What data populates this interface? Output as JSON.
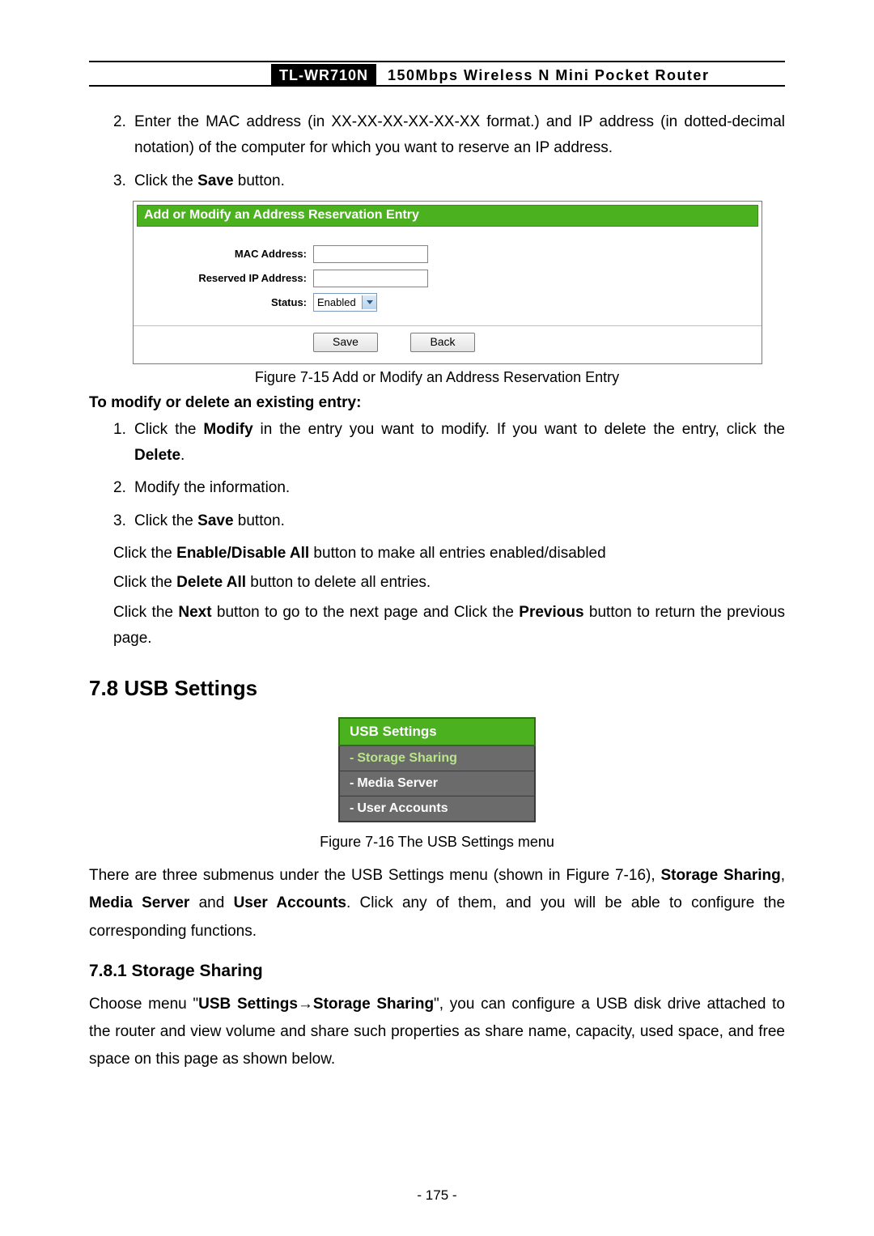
{
  "header": {
    "model": "TL-WR710N",
    "desc": "150Mbps Wireless N Mini Pocket Router"
  },
  "list1": {
    "item2_num": "2.",
    "item2_text": "Enter the MAC address (in XX-XX-XX-XX-XX-XX format.) and IP address (in dotted-decimal notation) of the computer for which you want to reserve an IP address.",
    "item3_num": "3.",
    "item3_a": "Click the ",
    "item3_b": "Save",
    "item3_c": " button."
  },
  "fig1": {
    "title": "Add or Modify an Address Reservation Entry",
    "label_mac": "MAC Address:",
    "label_ip": "Reserved IP Address:",
    "label_status": "Status:",
    "status_value": "Enabled",
    "btn_save": "Save",
    "btn_back": "Back",
    "caption": "Figure 7-15    Add or Modify an Address Reservation Entry"
  },
  "mod_section": {
    "heading": "To modify or delete an existing entry:",
    "i1_num": "1.",
    "i1_a": "Click the ",
    "i1_b": "Modify",
    "i1_c": " in the entry you want to modify. If you want to delete the entry, click the ",
    "i1_d": "Delete",
    "i1_e": ".",
    "i2_num": "2.",
    "i2_text": "Modify the information.",
    "i3_num": "3.",
    "i3_a": "Click the ",
    "i3_b": "Save",
    "i3_c": " button.",
    "p1_a": "Click the ",
    "p1_b": "Enable/Disable All",
    "p1_c": " button to make all entries enabled/disabled",
    "p2_a": "Click the ",
    "p2_b": "Delete All",
    "p2_c": " button to delete all entries.",
    "p3_a": "Click the ",
    "p3_b": "Next",
    "p3_c": " button to go to the next page and Click the ",
    "p3_d": "Previous",
    "p3_e": " button to return the previous page."
  },
  "sec78": {
    "heading": "7.8  USB Settings",
    "menu_head": "USB Settings",
    "menu1": "Storage Sharing",
    "menu2": "Media Server",
    "menu3": "User Accounts",
    "caption": "Figure 7-16 The USB Settings menu",
    "para_a": "There are three submenus under the USB Settings menu (shown in Figure 7-16), ",
    "para_b": "Storage Sharing",
    "para_c": ", ",
    "para_d": "Media Server",
    "para_e": " and ",
    "para_f": "User Accounts",
    "para_g": ". Click any of them, and you will be able to configure the corresponding functions."
  },
  "sec781": {
    "heading": "7.8.1  Storage Sharing",
    "p_a": "Choose menu \"",
    "p_b": "USB Settings",
    "p_arrow": "→",
    "p_c": "Storage Sharing",
    "p_d": "\", you can configure a USB disk drive attached to the router and view volume and share such properties as share name, capacity, used space, and free space on this page as shown below."
  },
  "page_number": "- 175 -"
}
